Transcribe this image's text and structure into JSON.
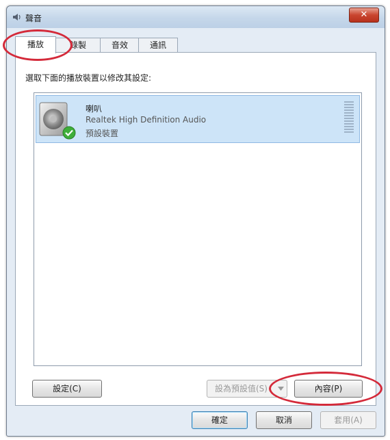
{
  "window": {
    "title": "聲音",
    "close_label": "✕"
  },
  "tabs": [
    {
      "label": "播放",
      "active": true
    },
    {
      "label": "錄製",
      "active": false
    },
    {
      "label": "音效",
      "active": false
    },
    {
      "label": "通訊",
      "active": false
    }
  ],
  "panel": {
    "instruction": "選取下面的播放裝置以修改其設定:",
    "device": {
      "name": "喇叭",
      "description": "Realtek High Definition Audio",
      "status": "預設裝置",
      "icon": "speaker-icon",
      "status_icon": "checkmark-icon"
    },
    "configure_label": "設定(C)",
    "set_default_label": "設為預設值(S)",
    "properties_label": "內容(P)"
  },
  "footer": {
    "ok_label": "確定",
    "cancel_label": "取消",
    "apply_label": "套用(A)"
  },
  "colors": {
    "highlight": "#d42a3a",
    "selection": "#cde4f8"
  }
}
